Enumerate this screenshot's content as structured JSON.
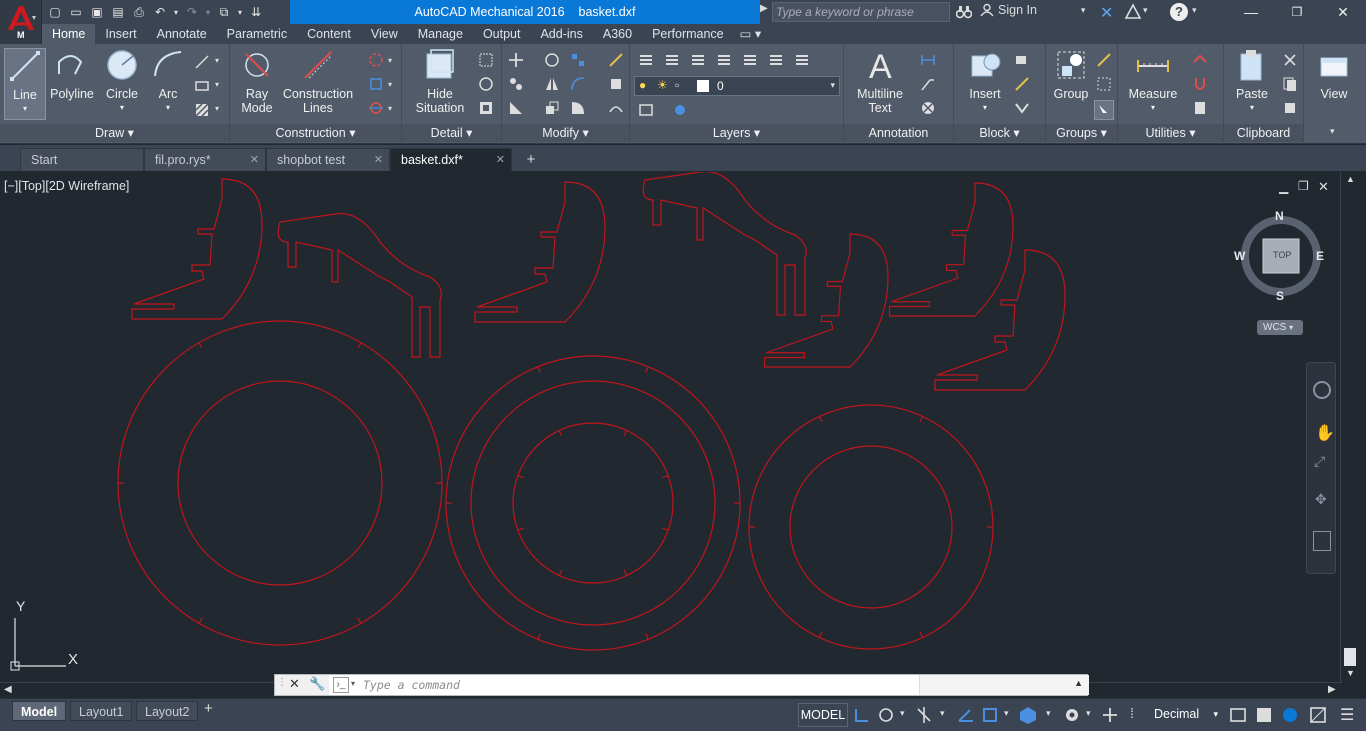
{
  "app": {
    "title": "AutoCAD Mechanical 2016",
    "filename": "basket.dxf",
    "app_button_letter": "M",
    "search_placeholder": "Type a keyword or phrase",
    "sign_in": "Sign In"
  },
  "ribbon_tabs": [
    "Home",
    "Insert",
    "Annotate",
    "Parametric",
    "Content",
    "View",
    "Manage",
    "Output",
    "Add-ins",
    "A360",
    "Performance"
  ],
  "ribbon_panels": {
    "draw": {
      "title": "Draw",
      "line": "Line",
      "polyline": "Polyline",
      "circle": "Circle",
      "arc": "Arc"
    },
    "construction": {
      "title": "Construction",
      "ray_mode_1": "Ray",
      "ray_mode_2": "Mode",
      "construction_lines_1": "Construction",
      "construction_lines_2": "Lines"
    },
    "detail": {
      "title": "Detail",
      "hide_situation_1": "Hide",
      "hide_situation_2": "Situation"
    },
    "modify": {
      "title": "Modify"
    },
    "layers": {
      "title": "Layers",
      "current_layer": "0"
    },
    "annotation": {
      "title": "Annotation",
      "mtext_1": "Multiline",
      "mtext_2": "Text"
    },
    "block": {
      "title": "Block",
      "insert": "Insert"
    },
    "groups": {
      "title": "Groups",
      "group": "Group"
    },
    "utilities": {
      "title": "Utilities",
      "measure": "Measure"
    },
    "clipboard": {
      "title": "Clipboard",
      "paste": "Paste"
    },
    "view": {
      "view": "View"
    }
  },
  "doc_tabs": [
    {
      "label": "Start"
    },
    {
      "label": "fil.pro.rys*"
    },
    {
      "label": "shopbot test"
    },
    {
      "label": "basket.dxf*"
    }
  ],
  "viewport": {
    "label": "[−][Top][2D Wireframe]",
    "viewcube": {
      "top": "TOP",
      "n": "N",
      "s": "S",
      "e": "E",
      "w": "W",
      "wcs": "WCS"
    },
    "ucs": {
      "x": "X",
      "y": "Y"
    },
    "drawing_color": "#c0151b"
  },
  "command": {
    "placeholder": "Type a command"
  },
  "layout_tabs": [
    "Model",
    "Layout1",
    "Layout2"
  ],
  "status": {
    "model": "MODEL",
    "units": "Decimal"
  },
  "colors": {
    "accent": "#0a78d7",
    "background": "#212830",
    "ribbon": "#525b69"
  }
}
